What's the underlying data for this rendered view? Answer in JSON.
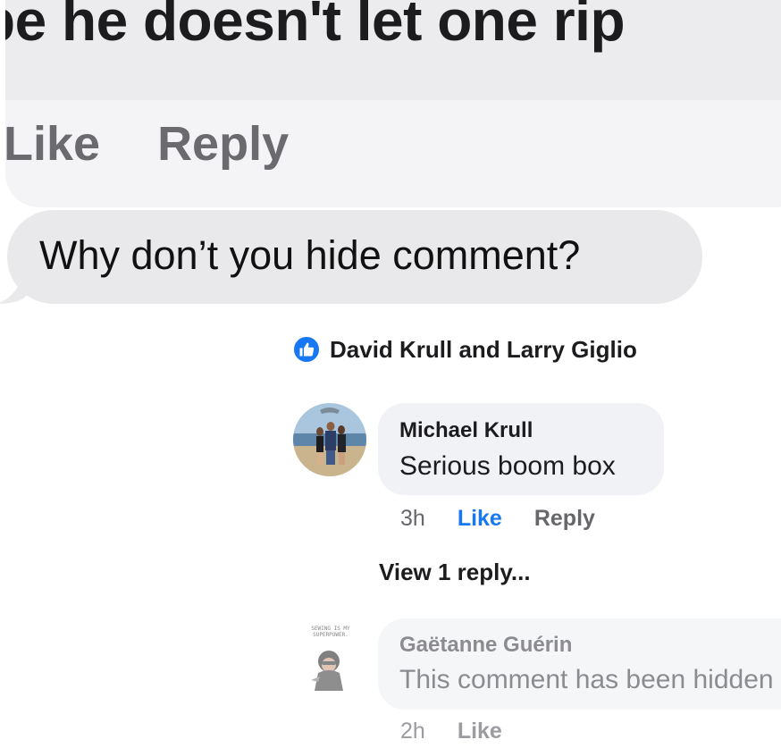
{
  "top_comment": {
    "text": "be he doesn't let one rip",
    "like_label": "Like",
    "reply_label": "Reply"
  },
  "message": {
    "text": "Why don’t you hide comment?"
  },
  "reactions": {
    "icon": "like-icon",
    "names": "David Krull and Larry Giglio"
  },
  "comments": [
    {
      "author": "Michael Krull",
      "text": "Serious boom box",
      "time": "3h",
      "like_label": "Like",
      "reply_label": "Reply"
    },
    {
      "author": "Gaëtanne Guérin",
      "text": "This comment has been hidden",
      "time": "2h",
      "like_label": "Like"
    }
  ],
  "view_replies_label": "View 1 reply...",
  "avatar2_badge_text": "SEWING IS MY SUPERPOWER.",
  "colors": {
    "accent": "#1877f2",
    "bubble": "#f0f2f5",
    "imessage_bubble": "#e9e9eb"
  }
}
